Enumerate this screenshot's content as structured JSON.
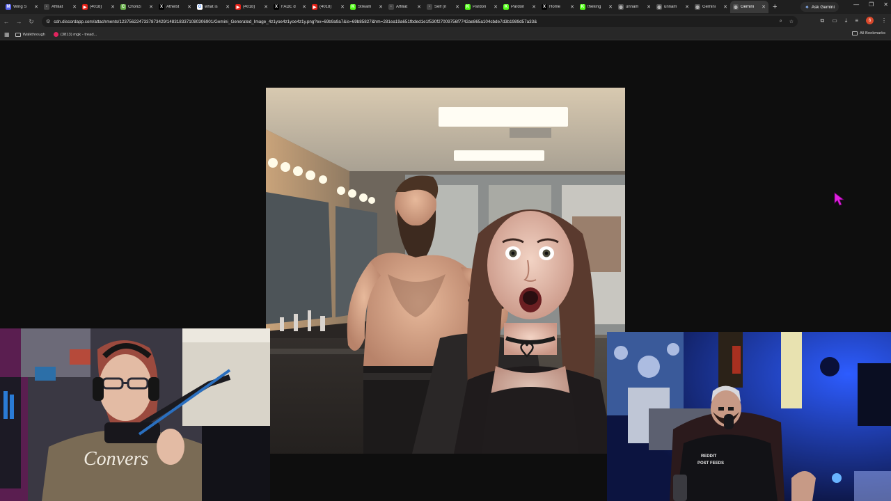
{
  "tabs": [
    {
      "label": "Wing S",
      "fav": "M",
      "color": "#5865f2"
    },
    {
      "label": "Affiliat",
      "fav": "·",
      "color": "#444444"
    },
    {
      "label": "(4018)",
      "fav": "▶",
      "color": "#e62117"
    },
    {
      "label": "Chonzi",
      "fav": "C",
      "color": "#6ab04c"
    },
    {
      "label": "Athelst",
      "fav": "X",
      "color": "#000000"
    },
    {
      "label": "what is",
      "fav": "G",
      "color": "#ffffff"
    },
    {
      "label": "(4018)",
      "fav": "▶",
      "color": "#e62117"
    },
    {
      "label": "FADE d",
      "fav": "X",
      "color": "#000000"
    },
    {
      "label": "(4018)",
      "fav": "▶",
      "color": "#e62117"
    },
    {
      "label": "Stream",
      "fav": "K",
      "color": "#53fc18"
    },
    {
      "label": "Affiliat",
      "fav": "·",
      "color": "#444444"
    },
    {
      "label": "Self (n",
      "fav": "·",
      "color": "#444444"
    },
    {
      "label": "Pardon",
      "fav": "K",
      "color": "#53fc18"
    },
    {
      "label": "Pardon",
      "fav": "K",
      "color": "#53fc18"
    },
    {
      "label": "Home",
      "fav": "X",
      "color": "#000000"
    },
    {
      "label": "theking",
      "fav": "K",
      "color": "#53fc18"
    },
    {
      "label": "unnam",
      "fav": "◎",
      "color": "#555555"
    },
    {
      "label": "unnam",
      "fav": "◎",
      "color": "#555555"
    },
    {
      "label": "Gemini",
      "fav": "◎",
      "color": "#555555"
    },
    {
      "label": "Gemini",
      "fav": "◎",
      "color": "#555555",
      "active": true
    }
  ],
  "ask_gemini": "Ask Gemini",
  "url": "cdn.discordapp.com/attachments/1237562247337873429/1483183371080306901/Gemini_Generated_Image_4z1yoe4z1yoe4z1y.png?ex=69b9a9a7&is=69b85827&hm=281ea19a651fbded1e1f530f27009756f7742ae865a104cbde7d3b1989d57a33&",
  "profile_initial": "6",
  "bookmarks": {
    "items": [
      {
        "label": "Walkthrough",
        "icon": "folder-icon"
      },
      {
        "label": "(3813) mgk - tread...",
        "icon": "youtube-icon"
      }
    ],
    "all_label": "All Bookmarks"
  },
  "colors": {
    "page_bg": "#0e0e0e",
    "tabbar_bg": "#1f1f1f",
    "toolbar_bg": "#282828",
    "cursor": "#e020e0"
  }
}
